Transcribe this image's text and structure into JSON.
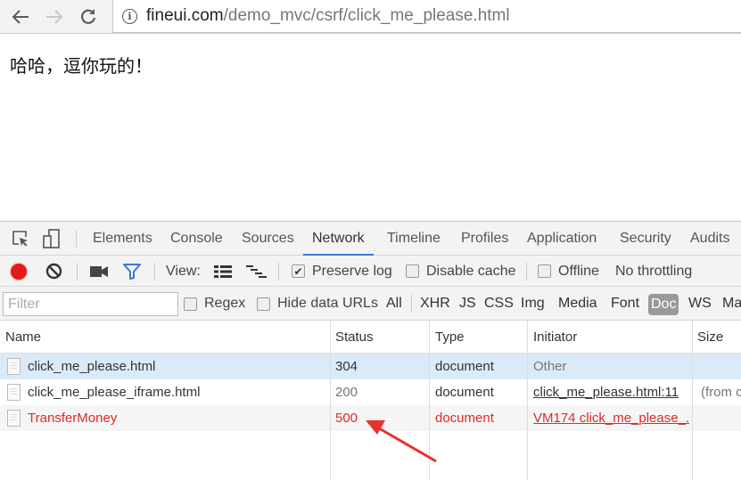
{
  "browser": {
    "url_host": "fineui.com",
    "url_path": "/demo_mvc/csrf/click_me_please.html",
    "back_icon": "arrow-left-icon",
    "forward_icon": "arrow-right-icon",
    "reload_icon": "reload-icon",
    "info_icon": "info-icon"
  },
  "page": {
    "text": "哈哈，逗你玩的！"
  },
  "devtools": {
    "tabs": [
      {
        "label": "Elements"
      },
      {
        "label": "Console"
      },
      {
        "label": "Sources"
      },
      {
        "label": "Network",
        "active": true
      },
      {
        "label": "Timeline"
      },
      {
        "label": "Profiles"
      },
      {
        "label": "Application"
      },
      {
        "label": "Security"
      },
      {
        "label": "Audits"
      }
    ],
    "toolbar": {
      "view_label": "View:",
      "preserve_log": {
        "label": "Preserve log",
        "checked": true
      },
      "disable_cache": {
        "label": "Disable cache",
        "checked": false
      },
      "offline": {
        "label": "Offline",
        "checked": false
      },
      "throttling": "No throttling",
      "record_color": "#e21b1b",
      "filter_color": "#3879d9"
    },
    "filterbar": {
      "placeholder": "Filter",
      "regex": {
        "label": "Regex",
        "checked": false
      },
      "hide_data_urls": {
        "label": "Hide data URLs",
        "checked": false
      },
      "types": [
        "All",
        "XHR",
        "JS",
        "CSS",
        "Img",
        "Media",
        "Font",
        "Doc",
        "WS",
        "Ma"
      ],
      "active_type": "Doc"
    },
    "table": {
      "columns": [
        "Name",
        "Status",
        "Type",
        "Initiator",
        "Size"
      ],
      "rows": [
        {
          "name": "click_me_please.html",
          "status": "304",
          "type": "document",
          "initiator": "Other",
          "size": ""
        },
        {
          "name": "click_me_please_iframe.html",
          "status": "200",
          "type": "document",
          "initiator": "click_me_please.html:11",
          "size": "(from c"
        },
        {
          "name": "TransferMoney",
          "status": "500",
          "type": "document",
          "initiator": "VM174 click_me_please_...",
          "size": ""
        }
      ],
      "error_color": "#e02a2a"
    }
  }
}
